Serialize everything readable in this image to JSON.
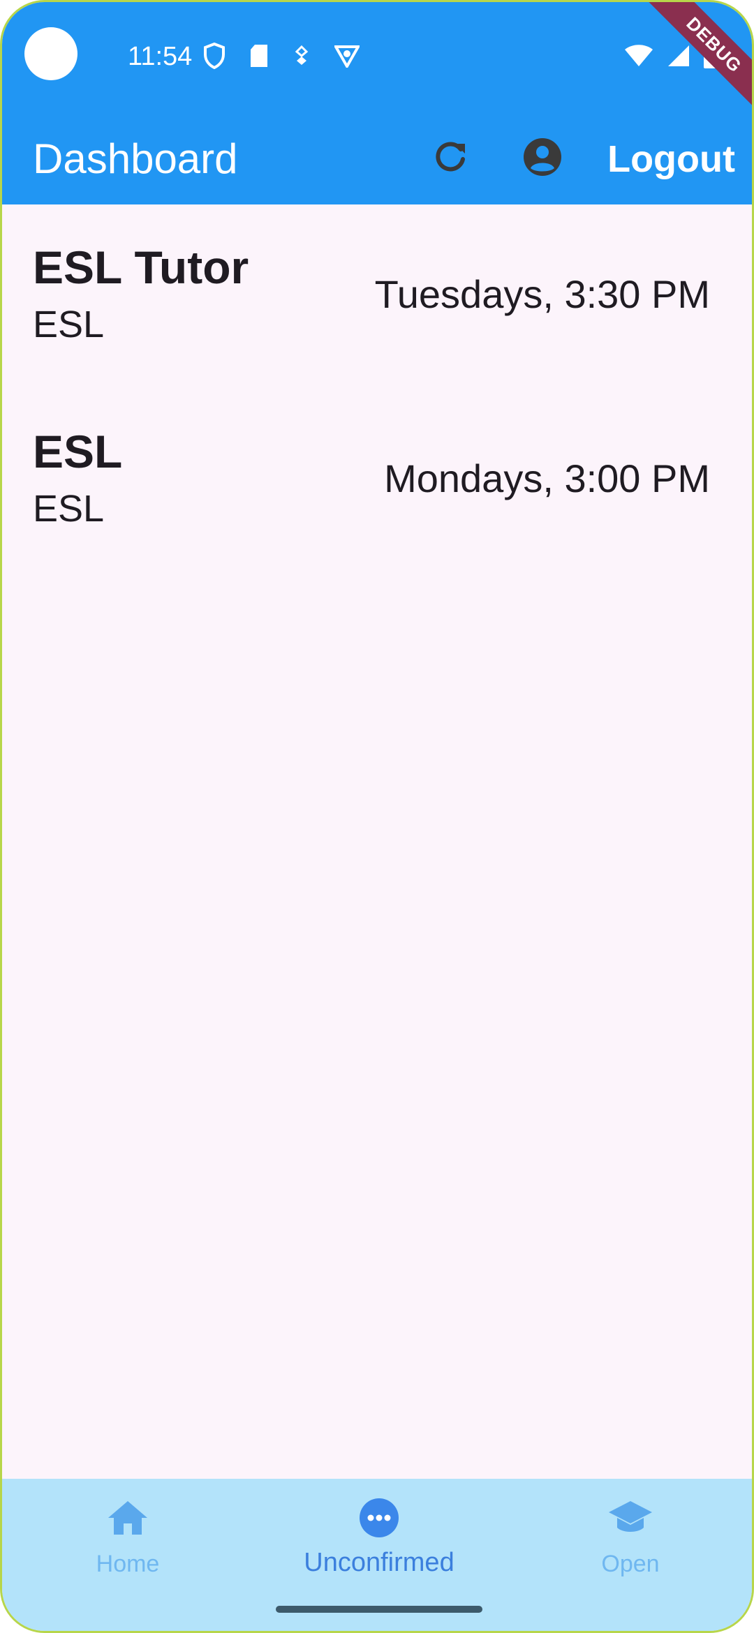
{
  "status_bar": {
    "time": "11:54"
  },
  "debug_ribbon": {
    "label": "DEBUG"
  },
  "app_bar": {
    "title": "Dashboard",
    "logout_label": "Logout"
  },
  "sessions": [
    {
      "title": "ESL Tutor",
      "subject": "ESL",
      "schedule": "Tuesdays, 3:30 PM"
    },
    {
      "title": "ESL",
      "subject": "ESL",
      "schedule": "Mondays, 3:00 PM"
    }
  ],
  "bottom_nav": {
    "items": [
      {
        "label": "Home",
        "icon": "home-icon",
        "active": false
      },
      {
        "label": "Unconfirmed",
        "icon": "more-horizontal-circle-icon",
        "active": true
      },
      {
        "label": "Open",
        "icon": "graduation-cap-icon",
        "active": false
      }
    ]
  },
  "colors": {
    "primary": "#2196f3",
    "background": "#fcf4fb",
    "bottom_nav_bg": "#b3e3fa",
    "nav_active": "#3b7fdd",
    "nav_inactive": "#6fb7f0",
    "debug_ribbon": "#8a2f4f"
  }
}
